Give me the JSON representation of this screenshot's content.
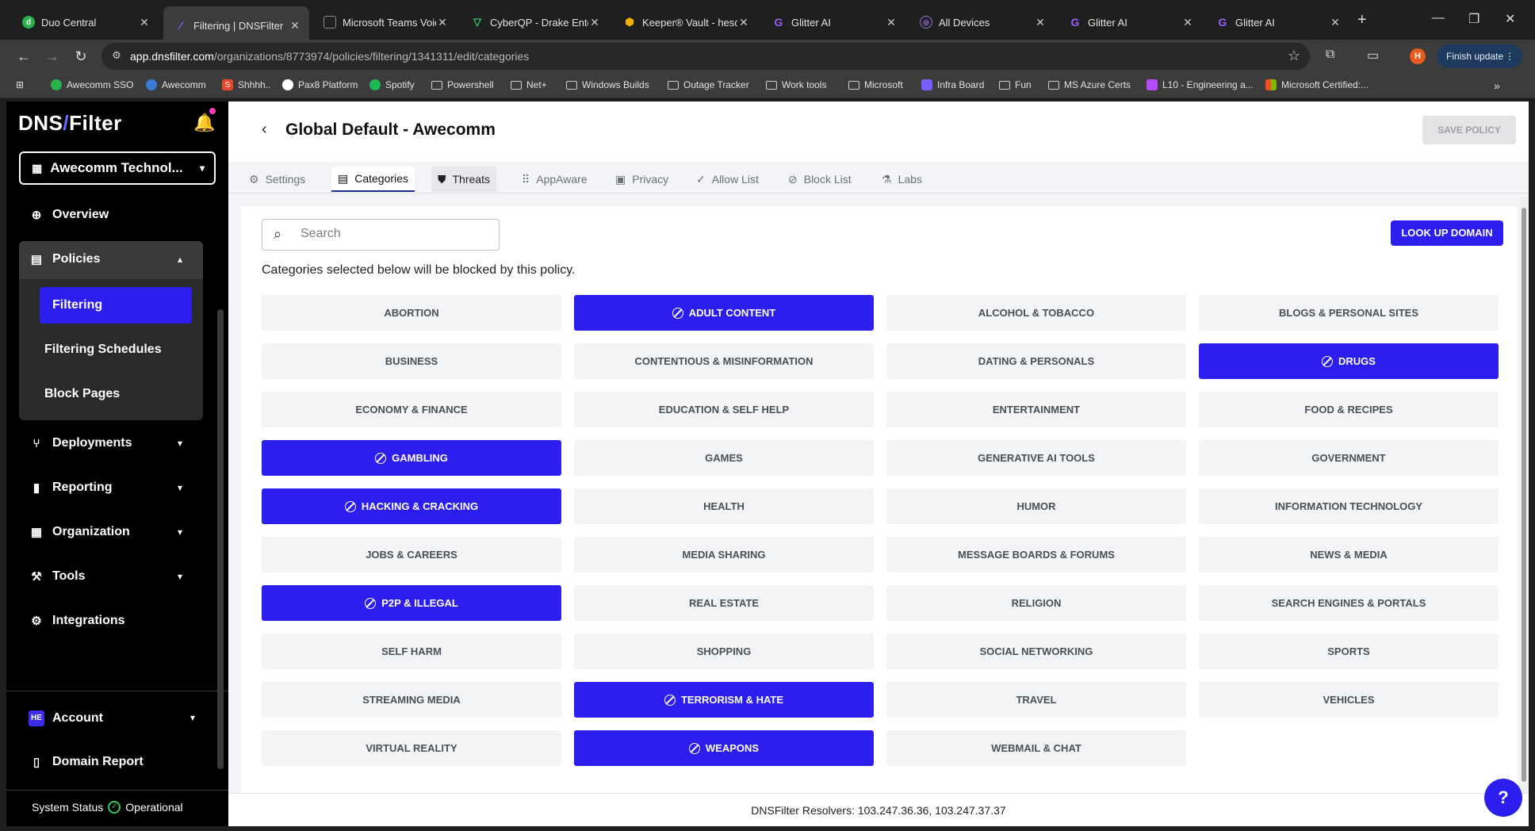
{
  "browser": {
    "tabs": [
      {
        "title": "Duo Central",
        "icon": "duo-icon",
        "color": "#2bb24c"
      },
      {
        "title": "Filtering | DNSFilter",
        "icon": "dnsfilter-icon",
        "color": "#3c2cf0"
      },
      {
        "title": "Microsoft Teams Voice",
        "icon": "teams-icon",
        "color": "#6264a7"
      },
      {
        "title": "CyberQP - Drake Enter",
        "icon": "cyberqp-icon",
        "color": "#2ecc71"
      },
      {
        "title": "Keeper® Vault - hesch",
        "icon": "keeper-icon",
        "color": "#f5b400"
      },
      {
        "title": "Glitter AI",
        "icon": "glitter-icon",
        "color": "#9b5cff"
      },
      {
        "title": "All Devices",
        "icon": "devices-icon",
        "color": "#a06cd5"
      },
      {
        "title": "Glitter AI",
        "icon": "glitter-icon",
        "color": "#9b5cff"
      },
      {
        "title": "Glitter AI",
        "icon": "glitter-icon",
        "color": "#9b5cff"
      }
    ],
    "url_host": "app.dnsfilter.com",
    "url_path": "/organizations/8773974/policies/filtering/1341311/edit/categories",
    "profile_initial": "H",
    "finish_update": "Finish update",
    "bookmarks": [
      {
        "label": "Awecomm SSO",
        "type": "site",
        "color": "#2bb24c"
      },
      {
        "label": "Awecomm",
        "type": "site",
        "color": "#3a7bd5"
      },
      {
        "label": "Shhhh..",
        "type": "site",
        "color": "#e8462a"
      },
      {
        "label": "Pax8 Platform",
        "type": "site",
        "color": "#ffffff"
      },
      {
        "label": "Spotify",
        "type": "site",
        "color": "#1db954"
      },
      {
        "label": "Powershell",
        "type": "folder"
      },
      {
        "label": "Net+",
        "type": "folder"
      },
      {
        "label": "Windows Builds",
        "type": "folder"
      },
      {
        "label": "Outage Tracker",
        "type": "folder"
      },
      {
        "label": "Work tools",
        "type": "folder"
      },
      {
        "label": "Microsoft",
        "type": "folder"
      },
      {
        "label": "Infra Board",
        "type": "site",
        "color": "#7b5cff"
      },
      {
        "label": "Fun",
        "type": "folder"
      },
      {
        "label": "MS Azure Certs",
        "type": "folder"
      },
      {
        "label": "L10 - Engineering a...",
        "type": "site",
        "color": "#b44cff"
      },
      {
        "label": "Microsoft Certified:...",
        "type": "site",
        "color": "#f25022"
      }
    ]
  },
  "sidebar": {
    "logo_left": "DNS",
    "logo_right": "Filter",
    "org_name": "Awecomm Technol...",
    "nav": {
      "overview": "Overview",
      "policies": "Policies",
      "filtering": "Filtering",
      "filtering_schedules": "Filtering Schedules",
      "block_pages": "Block Pages",
      "deployments": "Deployments",
      "reporting": "Reporting",
      "organization": "Organization",
      "tools": "Tools",
      "integrations": "Integrations",
      "account": "Account",
      "account_badge": "HE",
      "domain_report": "Domain Report"
    },
    "system_status_label": "System Status",
    "system_status_value": "Operational"
  },
  "main": {
    "title": "Global Default - Awecomm",
    "save_label": "SAVE POLICY",
    "tabs": [
      "Settings",
      "Categories",
      "Threats",
      "AppAware",
      "Privacy",
      "Allow List",
      "Block List",
      "Labs"
    ],
    "search_placeholder": "Search",
    "lookup_label": "LOOK UP DOMAIN",
    "description": "Categories selected below will be blocked by this policy.",
    "categories": [
      {
        "name": "ABORTION",
        "blocked": false
      },
      {
        "name": "ADULT CONTENT",
        "blocked": true
      },
      {
        "name": "ALCOHOL & TOBACCO",
        "blocked": false
      },
      {
        "name": "BLOGS & PERSONAL SITES",
        "blocked": false
      },
      {
        "name": "BUSINESS",
        "blocked": false
      },
      {
        "name": "CONTENTIOUS & MISINFORMATION",
        "blocked": false
      },
      {
        "name": "DATING & PERSONALS",
        "blocked": false
      },
      {
        "name": "DRUGS",
        "blocked": true
      },
      {
        "name": "ECONOMY & FINANCE",
        "blocked": false
      },
      {
        "name": "EDUCATION & SELF HELP",
        "blocked": false
      },
      {
        "name": "ENTERTAINMENT",
        "blocked": false
      },
      {
        "name": "FOOD & RECIPES",
        "blocked": false
      },
      {
        "name": "GAMBLING",
        "blocked": true
      },
      {
        "name": "GAMES",
        "blocked": false
      },
      {
        "name": "GENERATIVE AI TOOLS",
        "blocked": false
      },
      {
        "name": "GOVERNMENT",
        "blocked": false
      },
      {
        "name": "HACKING & CRACKING",
        "blocked": true
      },
      {
        "name": "HEALTH",
        "blocked": false
      },
      {
        "name": "HUMOR",
        "blocked": false
      },
      {
        "name": "INFORMATION TECHNOLOGY",
        "blocked": false
      },
      {
        "name": "JOBS & CAREERS",
        "blocked": false
      },
      {
        "name": "MEDIA SHARING",
        "blocked": false
      },
      {
        "name": "MESSAGE BOARDS & FORUMS",
        "blocked": false
      },
      {
        "name": "NEWS & MEDIA",
        "blocked": false
      },
      {
        "name": "P2P & ILLEGAL",
        "blocked": true
      },
      {
        "name": "REAL ESTATE",
        "blocked": false
      },
      {
        "name": "RELIGION",
        "blocked": false
      },
      {
        "name": "SEARCH ENGINES & PORTALS",
        "blocked": false
      },
      {
        "name": "SELF HARM",
        "blocked": false
      },
      {
        "name": "SHOPPING",
        "blocked": false
      },
      {
        "name": "SOCIAL NETWORKING",
        "blocked": false
      },
      {
        "name": "SPORTS",
        "blocked": false
      },
      {
        "name": "STREAMING MEDIA",
        "blocked": false
      },
      {
        "name": "TERRORISM & HATE",
        "blocked": true
      },
      {
        "name": "TRAVEL",
        "blocked": false
      },
      {
        "name": "VEHICLES",
        "blocked": false
      },
      {
        "name": "VIRTUAL REALITY",
        "blocked": false
      },
      {
        "name": "WEAPONS",
        "blocked": true
      },
      {
        "name": "WEBMAIL & CHAT",
        "blocked": false
      }
    ],
    "footer": "DNSFilter Resolvers: 103.247.36.36, 103.247.37.37"
  },
  "colors": {
    "accent": "#2d1ef0",
    "sidebar_bg": "#000000",
    "status_ok": "#32c864"
  }
}
